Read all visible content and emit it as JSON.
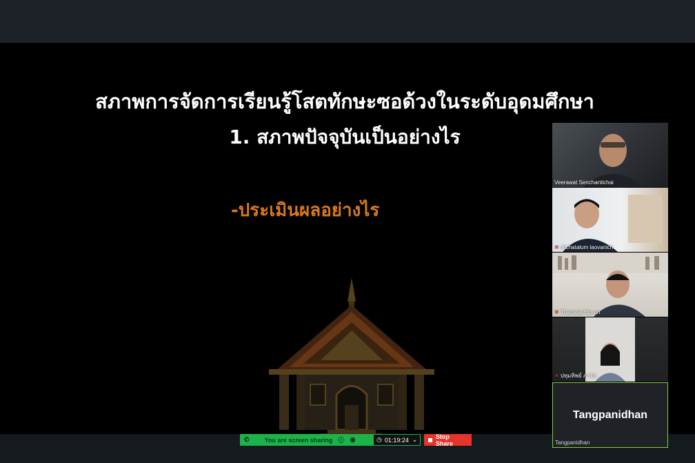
{
  "slide": {
    "title_line1": "สภาพการจัดการเรียนรู้โสตทักษะซอด้วงในระดับอุดมศึกษา",
    "title_line2": "1. สภาพปัจจุบันเป็นอย่างไร",
    "subtitle": "-ประเมินผลอย่างไร"
  },
  "share_bar": {
    "status": "You are screen sharing",
    "timer": "01:19:24",
    "stop_label": "Stop Share"
  },
  "participants": [
    {
      "name": "Veerawat Senchantichai",
      "muted": false
    },
    {
      "name": "vitchatalum laovanich",
      "muted": true
    },
    {
      "name": "Thanarat Hin-on",
      "muted": true
    },
    {
      "name": "ปทุมทิพย์ ภารัส",
      "muted": true
    },
    {
      "name": "Tangpanidhan",
      "display_name": "Tangpanidhan",
      "muted": false
    }
  ],
  "colors": {
    "accent_orange": "#d7791c",
    "share_green": "#1bb34a",
    "stop_red": "#e5352b",
    "active_border": "#7fd23e"
  }
}
